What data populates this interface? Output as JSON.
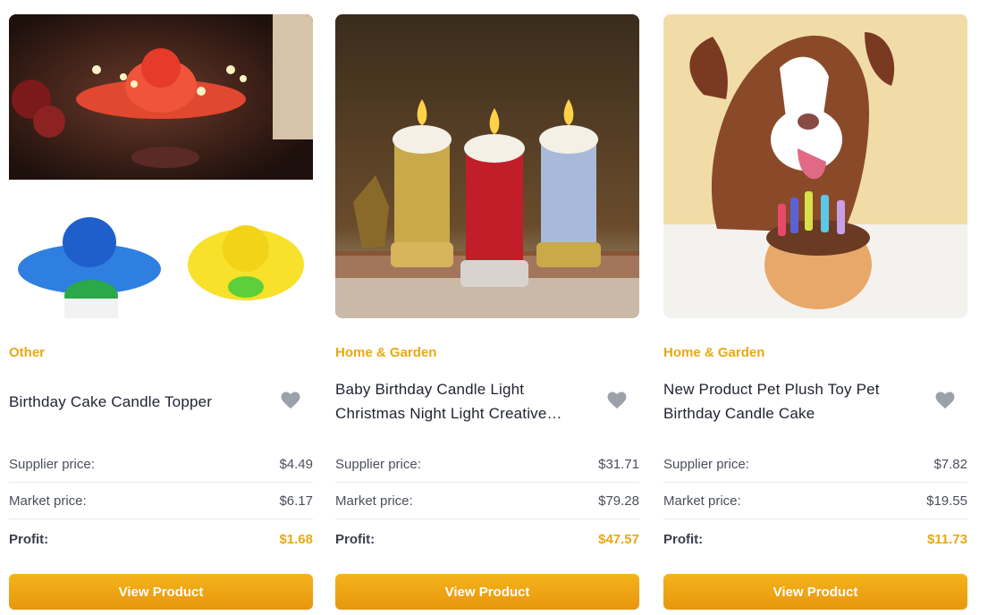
{
  "labels": {
    "supplier": "Supplier price:",
    "market": "Market price:",
    "profit": "Profit:",
    "button": "View Product"
  },
  "icons": {
    "favorite": "heart-icon"
  },
  "colors": {
    "accent": "#e8a912",
    "button_top": "#f4b41a",
    "button_bottom": "#e8960e",
    "heart": "#9aa1ab"
  },
  "products": [
    {
      "category": "Other",
      "title": "Birthday Cake Candle Topper",
      "supplier_price": "$4.49",
      "market_price": "$6.17",
      "profit": "$1.68"
    },
    {
      "category": "Home & Garden",
      "title": "Baby Birthday Candle Light Christmas Night Light Creative…",
      "supplier_price": "$31.71",
      "market_price": "$79.28",
      "profit": "$47.57"
    },
    {
      "category": "Home & Garden",
      "title": "New Product Pet Plush Toy Pet Birthday Candle Cake",
      "supplier_price": "$7.82",
      "market_price": "$19.55",
      "profit": "$11.73"
    }
  ]
}
